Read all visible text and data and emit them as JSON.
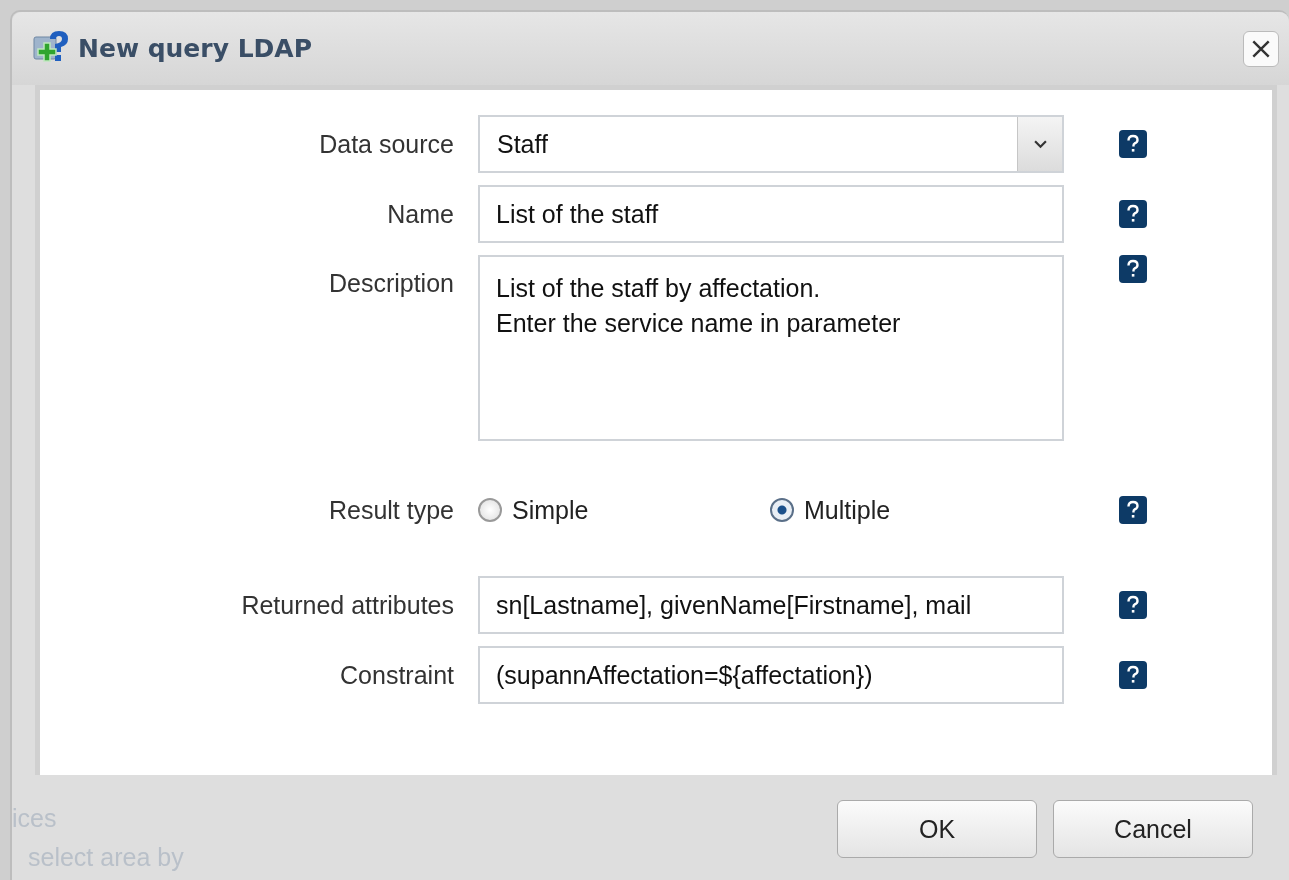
{
  "dialog": {
    "title": "New query LDAP"
  },
  "fields": [
    {
      "kind": "select",
      "label": "Data source",
      "value": "Staff"
    },
    {
      "kind": "text",
      "label": "Name",
      "value": "List of the staff"
    },
    {
      "kind": "textarea",
      "label": "Description",
      "value": "List of the staff by affectation.\nEnter the service name in parameter"
    },
    {
      "kind": "radio",
      "label": "Result type",
      "options": [
        {
          "label": "Simple",
          "selected": false
        },
        {
          "label": "Multiple",
          "selected": true
        }
      ]
    },
    {
      "kind": "text",
      "label": "Returned attributes",
      "value": "sn[Lastname], givenName[Firstname], mail"
    },
    {
      "kind": "text",
      "label": "Constraint",
      "value": "(supannAffectation=${affectation})"
    }
  ],
  "buttons": [
    "OK",
    "Cancel"
  ],
  "background_text": [
    "ices",
    "select area by"
  ]
}
